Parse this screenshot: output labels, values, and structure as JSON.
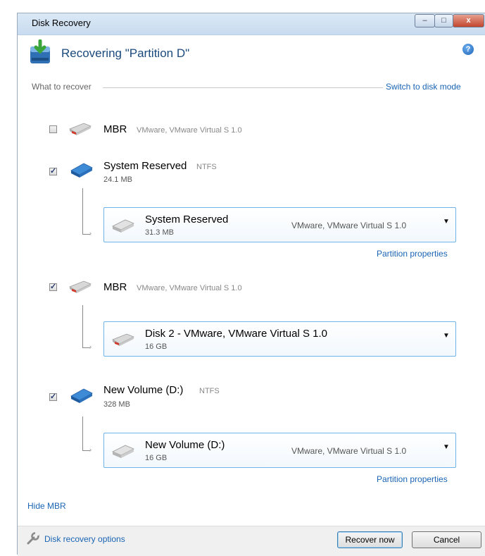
{
  "window": {
    "title": "Disk Recovery",
    "controls": {
      "minimize": "–",
      "maximize": "□",
      "close": "x"
    }
  },
  "header": {
    "title": "Recovering \"Partition D\"",
    "help": "?"
  },
  "section": {
    "label": "What to recover",
    "switch_link": "Switch to disk mode"
  },
  "items": [
    {
      "checked": false,
      "name": "MBR",
      "desc": "VMware, VMware Virtual S 1.0"
    },
    {
      "checked": true,
      "name": "System Reserved",
      "fs": "NTFS",
      "size": "24.1 MB",
      "target": {
        "name": "System Reserved",
        "size": "31.3 MB",
        "desc": "VMware, VMware Virtual S 1.0"
      },
      "properties_link": "Partition properties"
    },
    {
      "checked": true,
      "name": "MBR",
      "desc": "VMware, VMware Virtual S 1.0",
      "target": {
        "name": "Disk 2 - VMware, VMware Virtual S 1.0",
        "size": "16 GB"
      }
    },
    {
      "checked": true,
      "name": "New Volume (D:)",
      "fs": "NTFS",
      "size": "328 MB",
      "target": {
        "name": "New Volume (D:)",
        "size": "16 GB",
        "desc": "VMware, VMware Virtual S 1.0"
      },
      "properties_link": "Partition properties"
    }
  ],
  "hide_mbr_link": "Hide MBR",
  "footer": {
    "options_link": "Disk recovery options",
    "recover_button": "Recover now",
    "cancel_button": "Cancel"
  },
  "icons": {
    "app": "disk-recovery-icon",
    "help": "help-icon",
    "mbr_disk": "red-disk-icon",
    "partition": "blue-disk-icon",
    "target_partition": "grey-disk-icon",
    "dropdown": "chevron-down-icon",
    "options": "wrench-icon"
  },
  "colors": {
    "link": "#1a64b4",
    "title": "#1a4a7c",
    "target_border": "#6fb4e8"
  }
}
